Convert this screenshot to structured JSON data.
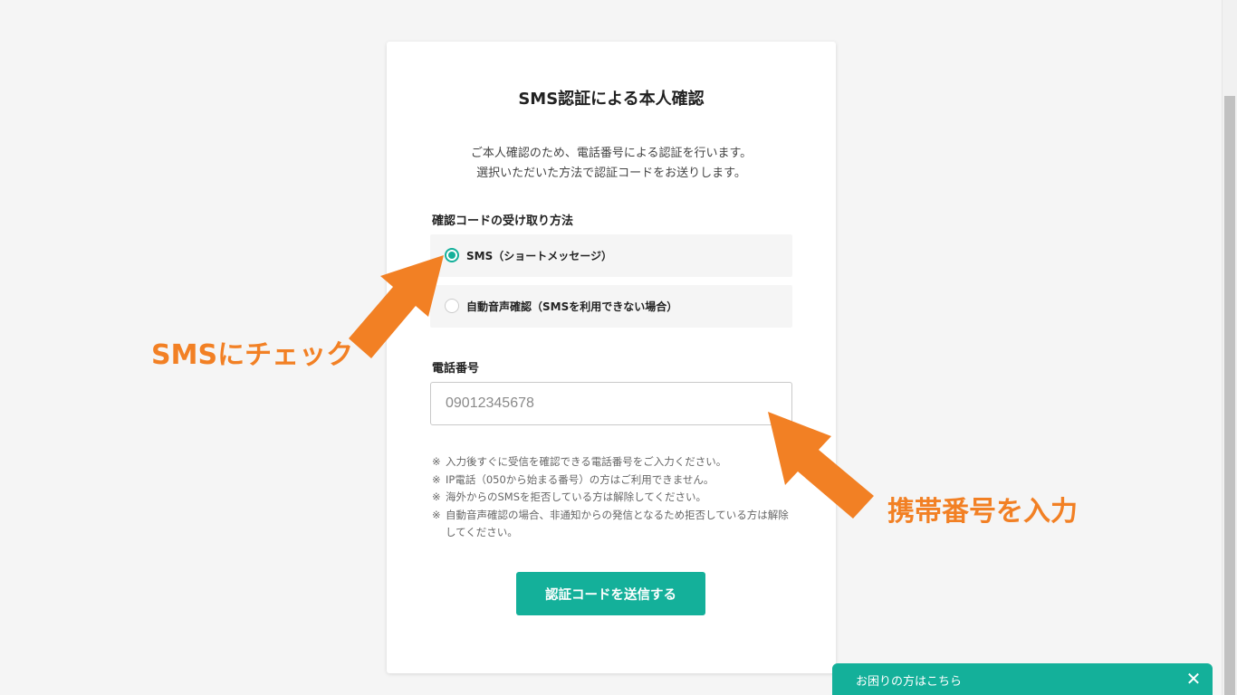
{
  "title": "SMS認証による本人確認",
  "description": {
    "line1": "ご本人確認のため、電話番号による認証を行います。",
    "line2": "選択いただいた方法で認証コードをお送りします。"
  },
  "method": {
    "label": "確認コードの受け取り方法",
    "options": [
      {
        "label": "SMS（ショートメッセージ）",
        "checked": true
      },
      {
        "label": "自動音声確認（SMSを利用できない場合）",
        "checked": false
      }
    ]
  },
  "phone": {
    "label": "電話番号",
    "placeholder": "09012345678",
    "value": ""
  },
  "notes": [
    {
      "mark": "※",
      "text": "入力後すぐに受信を確認できる電話番号をご入力ください。"
    },
    {
      "mark": "※",
      "text": "IP電話（050から始まる番号）の方はご利用できません。"
    },
    {
      "mark": "※",
      "text": "海外からのSMSを拒否している方は解除してください。"
    },
    {
      "mark": "※",
      "text": "自動音声確認の場合、非通知からの発信となるため拒否している方は解除してください。"
    }
  ],
  "submit_label": "認証コードを送信する",
  "help": {
    "label": "お困りの方はこちら",
    "close_symbol": "✕"
  },
  "annotations": {
    "sms_check": "SMSにチェック",
    "phone_input": "携帯番号を入力",
    "color": "#f28024"
  },
  "colors": {
    "accent": "#14b09a"
  }
}
